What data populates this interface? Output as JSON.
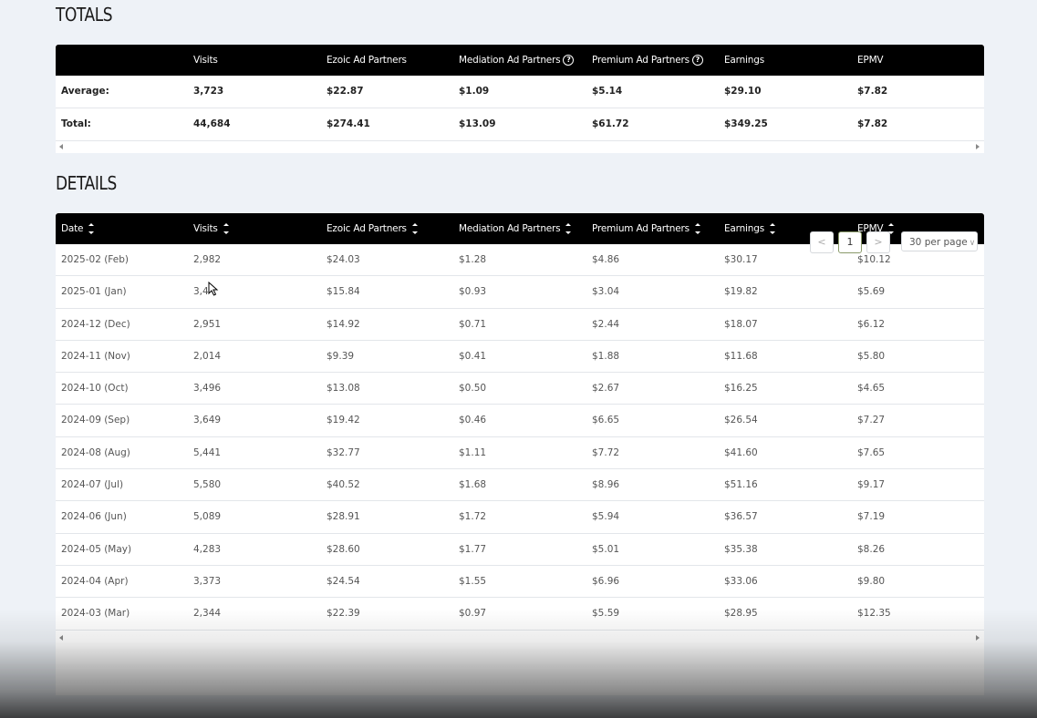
{
  "totals": {
    "title": "TOTALS",
    "columns": [
      "",
      "Visits",
      "Ezoic Ad Partners",
      "Mediation Ad Partners",
      "Premium Ad Partners",
      "Earnings",
      "EPMV"
    ],
    "help_icon": "question-circle-icon",
    "rows": [
      [
        "Average:",
        "3,723",
        "$22.87",
        "$1.09",
        "$5.14",
        "$29.10",
        "$7.82"
      ],
      [
        "Total:",
        "44,684",
        "$274.41",
        "$13.09",
        "$61.72",
        "$349.25",
        "$7.82"
      ]
    ]
  },
  "details": {
    "title": "DETAILS",
    "columns": [
      "Date",
      "Visits",
      "Ezoic Ad Partners",
      "Mediation Ad Partners",
      "Premium Ad Partners",
      "Earnings",
      "EPMV"
    ],
    "rows": [
      [
        "2025-02 (Feb)",
        "2,982",
        "$24.03",
        "$1.28",
        "$4.86",
        "$30.17",
        "$10.12"
      ],
      [
        "2025-01 (Jan)",
        "3,4",
        "$15.84",
        "$0.93",
        "$3.04",
        "$19.82",
        "$5.69"
      ],
      [
        "2024-12 (Dec)",
        "2,951",
        "$14.92",
        "$0.71",
        "$2.44",
        "$18.07",
        "$6.12"
      ],
      [
        "2024-11 (Nov)",
        "2,014",
        "$9.39",
        "$0.41",
        "$1.88",
        "$11.68",
        "$5.80"
      ],
      [
        "2024-10 (Oct)",
        "3,496",
        "$13.08",
        "$0.50",
        "$2.67",
        "$16.25",
        "$4.65"
      ],
      [
        "2024-09 (Sep)",
        "3,649",
        "$19.42",
        "$0.46",
        "$6.65",
        "$26.54",
        "$7.27"
      ],
      [
        "2024-08 (Aug)",
        "5,441",
        "$32.77",
        "$1.11",
        "$7.72",
        "$41.60",
        "$7.65"
      ],
      [
        "2024-07 (Jul)",
        "5,580",
        "$40.52",
        "$1.68",
        "$8.96",
        "$51.16",
        "$9.17"
      ],
      [
        "2024-06 (Jun)",
        "5,089",
        "$28.91",
        "$1.72",
        "$5.94",
        "$36.57",
        "$7.19"
      ],
      [
        "2024-05 (May)",
        "4,283",
        "$28.60",
        "$1.77",
        "$5.01",
        "$35.38",
        "$8.26"
      ],
      [
        "2024-04 (Apr)",
        "3,373",
        "$24.54",
        "$1.55",
        "$6.96",
        "$33.06",
        "$9.80"
      ],
      [
        "2024-03 (Mar)",
        "2,344",
        "$22.39",
        "$0.97",
        "$5.59",
        "$28.95",
        "$12.35"
      ]
    ]
  },
  "pagination": {
    "prev": "<",
    "page": "1",
    "next": ">",
    "per_page": "30 per page"
  },
  "colors": {
    "header_bg": "#000000",
    "page_bg": "#eef2f7",
    "active_page_border": "#8a9a6a"
  }
}
